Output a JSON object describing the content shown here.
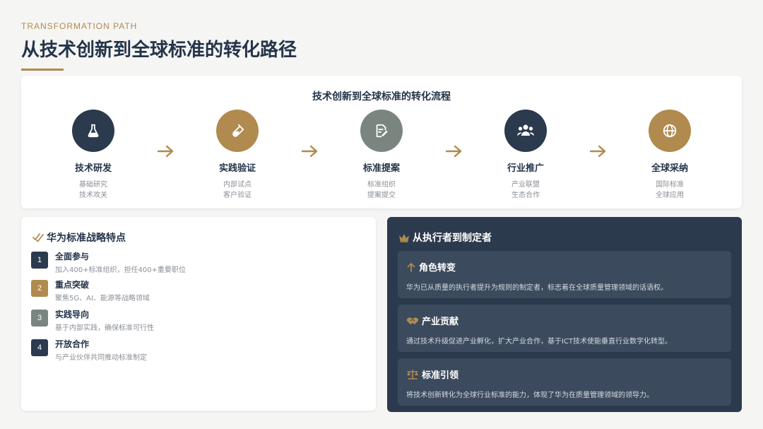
{
  "header": {
    "subtitle": "TRANSFORMATION PATH",
    "title": "从技术创新到全球标准的转化路径"
  },
  "flow": {
    "title": "技术创新到全球标准的转化流程",
    "steps": [
      {
        "name": "技术研发",
        "d1": "基础研究",
        "d2": "技术攻关",
        "icon": "flask-icon",
        "color": "#2b3a4d"
      },
      {
        "name": "实践验证",
        "d1": "内部试点",
        "d2": "客户验证",
        "icon": "test-tube-icon",
        "color": "#b08a4e"
      },
      {
        "name": "标准提案",
        "d1": "标准组织",
        "d2": "提案提交",
        "icon": "document-edit-icon",
        "color": "#7a8580"
      },
      {
        "name": "行业推广",
        "d1": "产业联盟",
        "d2": "生态合作",
        "icon": "users-icon",
        "color": "#2b3a4d"
      },
      {
        "name": "全球采纳",
        "d1": "国际标准",
        "d2": "全球应用",
        "icon": "globe-icon",
        "color": "#b08a4e"
      }
    ]
  },
  "strategy": {
    "title": "华为标准战略特点",
    "items": [
      {
        "num": "1",
        "name": "全面参与",
        "desc": "加入400+标准组织，担任400+重要职位",
        "color": "#2b3a4d"
      },
      {
        "num": "2",
        "name": "重点突破",
        "desc": "聚焦5G、AI、能源等战略领域",
        "color": "#b08a4e"
      },
      {
        "num": "3",
        "name": "实践导向",
        "desc": "基于内部实践，确保标准可行性",
        "color": "#7a8580"
      },
      {
        "num": "4",
        "name": "开放合作",
        "desc": "与产业伙伴共同推动标准制定",
        "color": "#2b3a4d"
      }
    ]
  },
  "role": {
    "title": "从执行者到制定者",
    "items": [
      {
        "name": "角色转变",
        "desc": "华为已从质量的执行者提升为规则的制定者，标志着在全球质量管理领域的话语权。",
        "icon": "arrow-up-icon"
      },
      {
        "name": "产业贡献",
        "desc": "通过技术升级促进产业孵化，扩大产业合作，基于ICT技术使能垂直行业数字化转型。",
        "icon": "handshake-icon"
      },
      {
        "name": "标准引领",
        "desc": "将技术创新转化为全球行业标准的能力，体现了华为在质量管理领域的领导力。",
        "icon": "balance-scale-icon"
      }
    ]
  },
  "colors": {
    "navy": "#2b3a4d",
    "gold": "#b08a4e",
    "gray": "#7a8580"
  }
}
